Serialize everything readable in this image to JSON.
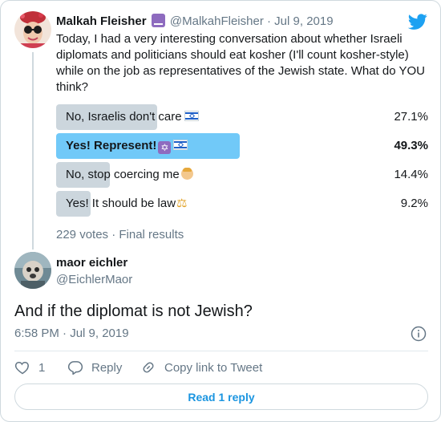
{
  "parent_tweet": {
    "author_name": "Malkah Fleisher",
    "author_handle": "@MalkahFleisher",
    "separator": "·",
    "date": "Jul 9, 2019",
    "name_emoji": "menorah-emoji",
    "text": "Today, I had a very interesting conversation about whether Israeli diplomats and politicians should eat kosher (I'll count kosher-style) while on the job as representatives of the Jewish state. What do YOU think?",
    "poll": {
      "options": [
        {
          "label": "No, Israelis don't care",
          "emoji": "israel-flag",
          "percent_text": "27.1%",
          "percent": 27.1,
          "winner": false
        },
        {
          "label": "Yes! Represent!",
          "emoji": "star-of-david israel-flag",
          "percent_text": "49.3%",
          "percent": 49.3,
          "winner": true
        },
        {
          "label": "No, stop coercing me",
          "emoji": "person-gesturing-no",
          "percent_text": "14.4%",
          "percent": 14.4,
          "winner": false
        },
        {
          "label": "Yes! It should be law",
          "emoji": "balance-scale",
          "percent_text": "9.2%",
          "percent": 9.2,
          "winner": false
        }
      ],
      "votes_text": "229 votes · Final results"
    }
  },
  "main_tweet": {
    "author_name": "maor eichler",
    "author_handle": "@EichlerMaor",
    "text": "And if the diplomat is not Jewish?",
    "timestamp": "6:58 PM · Jul 9, 2019"
  },
  "actions": {
    "like_count": "1",
    "reply_label": "Reply",
    "copy_link_label": "Copy link to Tweet"
  },
  "read_reply_label": "Read 1 reply",
  "colors": {
    "twitter_blue": "#1da1f2",
    "link_blue": "#1b95e0",
    "poll_winner": "#71c9f8",
    "poll_bar": "#ccd6dd",
    "muted_text": "#657786"
  },
  "icons": [
    "twitter-bird-icon",
    "info-icon",
    "heart-icon",
    "reply-icon",
    "link-icon"
  ]
}
